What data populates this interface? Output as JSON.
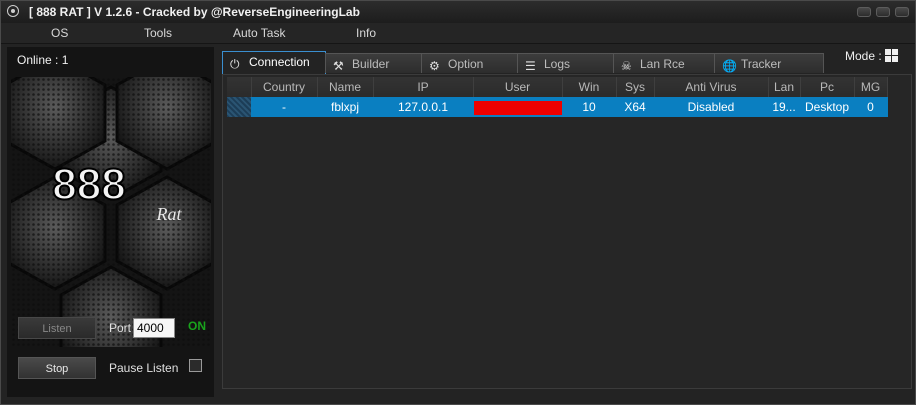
{
  "window": {
    "title": "[  888 RAT  ] V 1.2.6 - Cracked by @ReverseEngineeringLab"
  },
  "menu": [
    "OS",
    "Tools",
    "Auto Task",
    "Info"
  ],
  "left_panel": {
    "online_label": "Online : 1",
    "logo_text": "888",
    "logo_sub": "Rat",
    "listen_label": "Listen",
    "port_label": "Port",
    "port_value": "4000",
    "status": "ON",
    "status_color": "#19a31c",
    "stop_label": "Stop",
    "pause_label": "Pause Listen"
  },
  "mode_label": "Mode :",
  "tabs": [
    {
      "label": "Connection",
      "icon": "plug-icon"
    },
    {
      "label": "Builder",
      "icon": "tools-icon"
    },
    {
      "label": "Option",
      "icon": "gear-icon"
    },
    {
      "label": "Logs",
      "icon": "database-icon"
    },
    {
      "label": "Lan Rce",
      "icon": "skull-icon"
    },
    {
      "label": "Tracker",
      "icon": "globe-icon"
    }
  ],
  "table": {
    "columns": [
      "",
      "Country",
      "Name",
      "IP",
      "User",
      "Win",
      "Sys",
      "Anti Virus",
      "Lan",
      "Pc",
      "MG"
    ],
    "rows": [
      [
        "",
        "-",
        "fblxpj",
        "127.0.0.1",
        "",
        "10",
        "X64",
        "Disabled",
        "19...",
        "Desktop",
        "0"
      ]
    ],
    "selected_row_color": "#0a7fc1",
    "redaction_color": "#ee0000"
  }
}
